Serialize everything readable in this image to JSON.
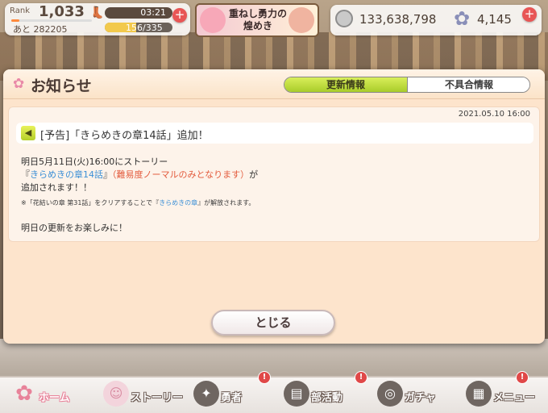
{
  "hud": {
    "rank_label": "Rank",
    "rank_value": "1,033",
    "rank_next": "あと 282205",
    "stamina_time": "03:21",
    "stamina_value": "156/335",
    "stamina_progress": 0.47,
    "event_banner_title": "重ねし勇力の煌めき",
    "coins": "133,638,798",
    "gems": "4,145",
    "plus_symbol": "+"
  },
  "dialog": {
    "title": "お知らせ",
    "tabs": [
      {
        "label": "更新情報",
        "active": true
      },
      {
        "label": "不具合情報",
        "active": false
      }
    ],
    "date": "2021.05.10 16:00",
    "notice_title": "[予告]「きらめきの章14話」追加！",
    "line1": "明日5月11日(火)16:00にストーリー",
    "line2_prefix": "『",
    "line2_blue": "きらめきの章14話",
    "line2_mid": "』",
    "line2_red": "（難易度ノーマルのみとなります）",
    "line2_suffix": "が",
    "line3": "追加されます！！",
    "note_prefix": "※「花結いの章 第31話」をクリアすることで『",
    "note_blue": "きらめきの章",
    "note_suffix": "』が解放されます。",
    "closing": "明日の更新をお楽しみに！",
    "close_button": "とじる"
  },
  "nav": [
    {
      "label": "ホーム",
      "icon": "home-icon",
      "badge": false
    },
    {
      "label": "ストーリー",
      "icon": "story-icon",
      "badge": false
    },
    {
      "label": "勇者",
      "icon": "hero-icon",
      "badge": true
    },
    {
      "label": "部活動",
      "icon": "club-icon",
      "badge": true
    },
    {
      "label": "ガチャ",
      "icon": "gacha-icon",
      "badge": false
    },
    {
      "label": "メニュー",
      "icon": "menu-icon",
      "badge": true
    }
  ],
  "badge_symbol": "!",
  "colors": {
    "accent_green": "#b5cf2a",
    "dialog_bg": "#fde4cc",
    "highlight_blue": "#3b8fd6",
    "highlight_red": "#e35b3d"
  }
}
